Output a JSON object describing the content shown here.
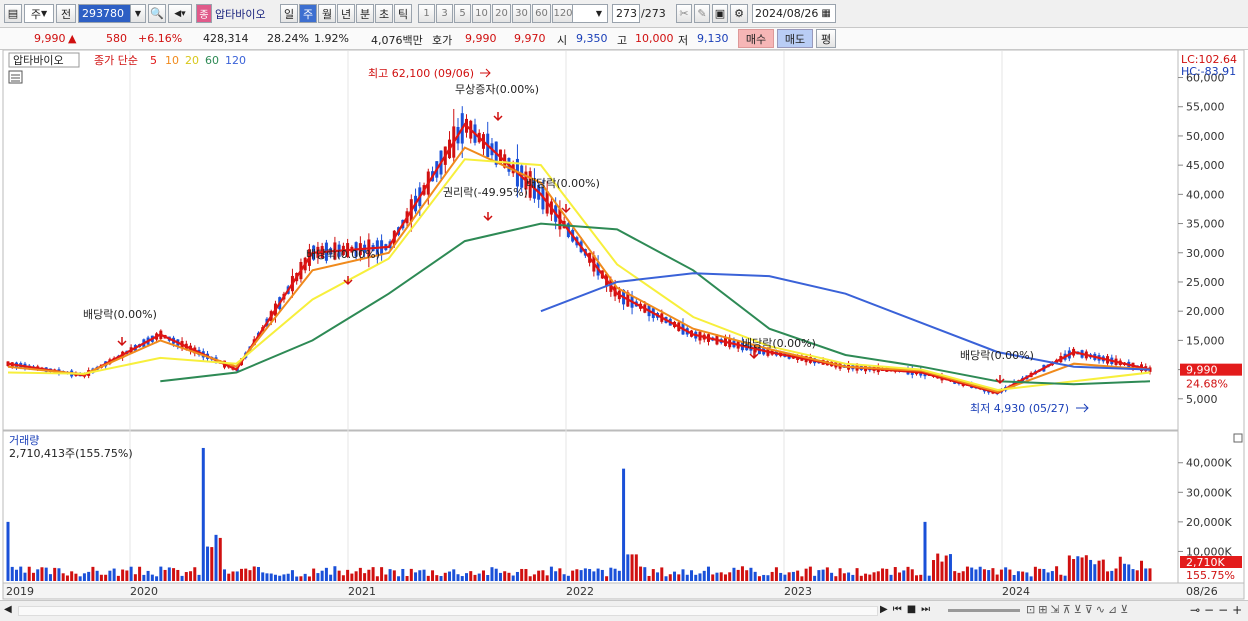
{
  "toolbar": {
    "period_select": "주",
    "prev_label": "전",
    "code": "293780",
    "stock_name": "압타바이오",
    "name_badge": "종",
    "periods": [
      "일",
      "주",
      "월",
      "년",
      "분",
      "초",
      "틱"
    ],
    "active_period": "주",
    "intervals": [
      "1",
      "3",
      "5",
      "10",
      "20",
      "30",
      "60",
      "120"
    ],
    "count": "273",
    "count_total": "/273",
    "date": "2024/08/26"
  },
  "quote": {
    "price": "9,990",
    "change_arrow": "▲",
    "change": "580",
    "change_pct": "+6.16%",
    "volume": "428,314",
    "turnover_pct": "28.24%",
    "ratio": "1.92%",
    "trade_value": "4,076백만",
    "bid_label": "호가",
    "ask_price": "9,990",
    "bid_price": "9,970",
    "open_label": "시",
    "open": "9,350",
    "high_label": "고",
    "high": "10,000",
    "low_label": "저",
    "low": "9,130",
    "buy_button": "매수",
    "sell_button": "매도",
    "eval_button": "평"
  },
  "price_panel": {
    "stock_tag": "압타바이오",
    "legend_title": "종가 단순",
    "ma_periods": [
      "5",
      "10",
      "20",
      "60",
      "120"
    ],
    "lc": "LC:102.64",
    "hc": "HC:-83.91",
    "y_ticks": [
      "60,000",
      "55,000",
      "50,000",
      "45,000",
      "40,000",
      "35,000",
      "30,000",
      "25,000",
      "20,000",
      "15,000",
      "10,000",
      "5,000"
    ],
    "current_price_tag": "9,990",
    "current_pct_tag": "24.68%",
    "high_annotation": "최고 62,100 (09/06)",
    "low_annotation": "최저 4,930 (05/27)",
    "annotations": [
      "배당락(0.00%)",
      "배당락(0.00%)",
      "권리락(-49.95%)",
      "무상증자(0.00%)",
      "배당락(0.00%)",
      "배당락(0.00%)",
      "배당락(0.00%)"
    ]
  },
  "volume_panel": {
    "title": "거래량",
    "value": "2,710,413주(155.75%)",
    "y_ticks": [
      "40,000K",
      "30,000K",
      "20,000K",
      "10,000K"
    ],
    "current_tag": "2,710K",
    "current_pct": "155.75%"
  },
  "x_axis": [
    "2019",
    "2020",
    "2021",
    "2022",
    "2023",
    "2024",
    "08/26"
  ],
  "colors": {
    "up": "#d01010",
    "down": "#1a50d8",
    "ma5": "#e01515",
    "ma10": "#f08a1c",
    "ma20": "#f7ef3c",
    "ma60": "#2e8a55",
    "ma120": "#3a62d8"
  },
  "chart_data": {
    "type": "candlestick",
    "x": [
      "2019",
      "2020",
      "2021",
      "2022",
      "2023",
      "2024",
      "08/26"
    ],
    "ylim": [
      0,
      63000
    ],
    "series": [
      {
        "name": "5",
        "values": [
          11000,
          9000,
          16000,
          10000,
          30000,
          31000,
          52000,
          40000,
          23000,
          16000,
          13000,
          10500,
          9500,
          6000,
          13000,
          9990
        ]
      },
      {
        "name": "10",
        "values": [
          10500,
          9200,
          15000,
          10500,
          27000,
          30000,
          48000,
          42000,
          24000,
          17000,
          13500,
          10500,
          9800,
          6200,
          11000,
          10000
        ]
      },
      {
        "name": "20",
        "values": [
          9500,
          9300,
          12000,
          11000,
          22000,
          29000,
          46000,
          45000,
          28000,
          19000,
          14000,
          11000,
          10000,
          6500,
          8000,
          9500
        ]
      },
      {
        "name": "60",
        "values": [
          null,
          null,
          8000,
          9500,
          15000,
          23000,
          32000,
          35000,
          34000,
          27000,
          17000,
          12500,
          10500,
          8000,
          7500,
          8000
        ]
      },
      {
        "name": "120",
        "values": [
          null,
          null,
          null,
          null,
          null,
          null,
          null,
          20000,
          25000,
          26500,
          26000,
          23000,
          18000,
          13000,
          10500,
          9990
        ]
      }
    ],
    "high": 62100,
    "low": 4930,
    "last": 9990
  }
}
